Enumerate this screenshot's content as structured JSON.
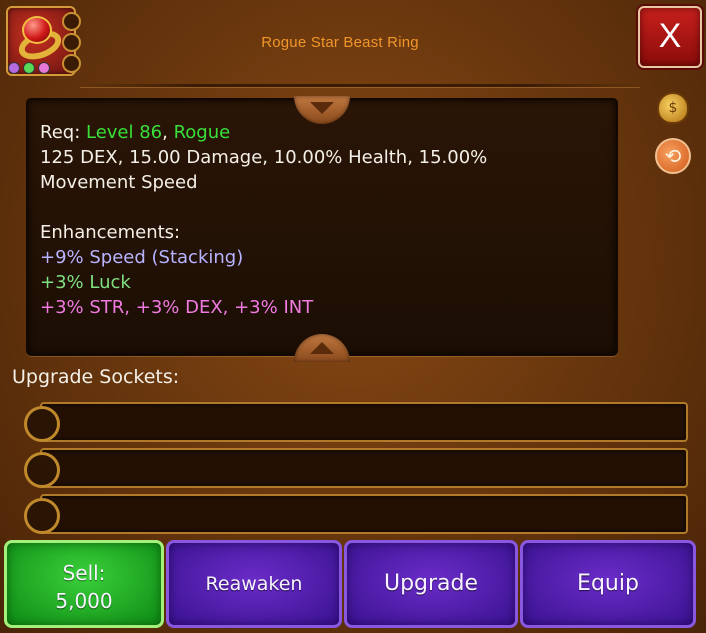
{
  "item": {
    "title": "Rogue Star Beast Ring",
    "gem_dots": [
      "#b56ae0",
      "#58d858",
      "#e878d8"
    ]
  },
  "close": {
    "label": "X"
  },
  "description": {
    "req_label": "Req: ",
    "req_level": "Level 86",
    "req_sep": ", ",
    "req_class": "Rogue",
    "stats_line1": "125 DEX, 15.00 Damage, 10.00% Health, 15.00%",
    "stats_line2": "Movement Speed",
    "enhancements_label": "Enhancements:",
    "enh_speed": "+9% Speed (Stacking)",
    "enh_luck": "+3% Luck",
    "enh_stats": "+3% STR, +3% DEX, +3% INT"
  },
  "sockets": {
    "label": "Upgrade Sockets:",
    "slots": [
      "",
      "",
      ""
    ]
  },
  "actions": {
    "sell_label": "Sell:",
    "sell_price": "5,000",
    "reawaken": "Reawaken",
    "upgrade": "Upgrade",
    "equip": "Equip"
  },
  "icons": {
    "item": "ring-icon",
    "close": "close-icon",
    "gold": "gold-bag-icon",
    "swap": "swap-icon",
    "scroll_up": "scroll-up-icon",
    "scroll_down": "scroll-down-icon"
  },
  "colors": {
    "title": "#f0962a",
    "level": "#38e038",
    "enh_speed": "#b8b4ff",
    "enh_luck": "#80e080",
    "enh_stats": "#f07ae0",
    "sell_button": "#1ea82a",
    "action_button": "#5222b0",
    "close_button": "#c01a18"
  }
}
